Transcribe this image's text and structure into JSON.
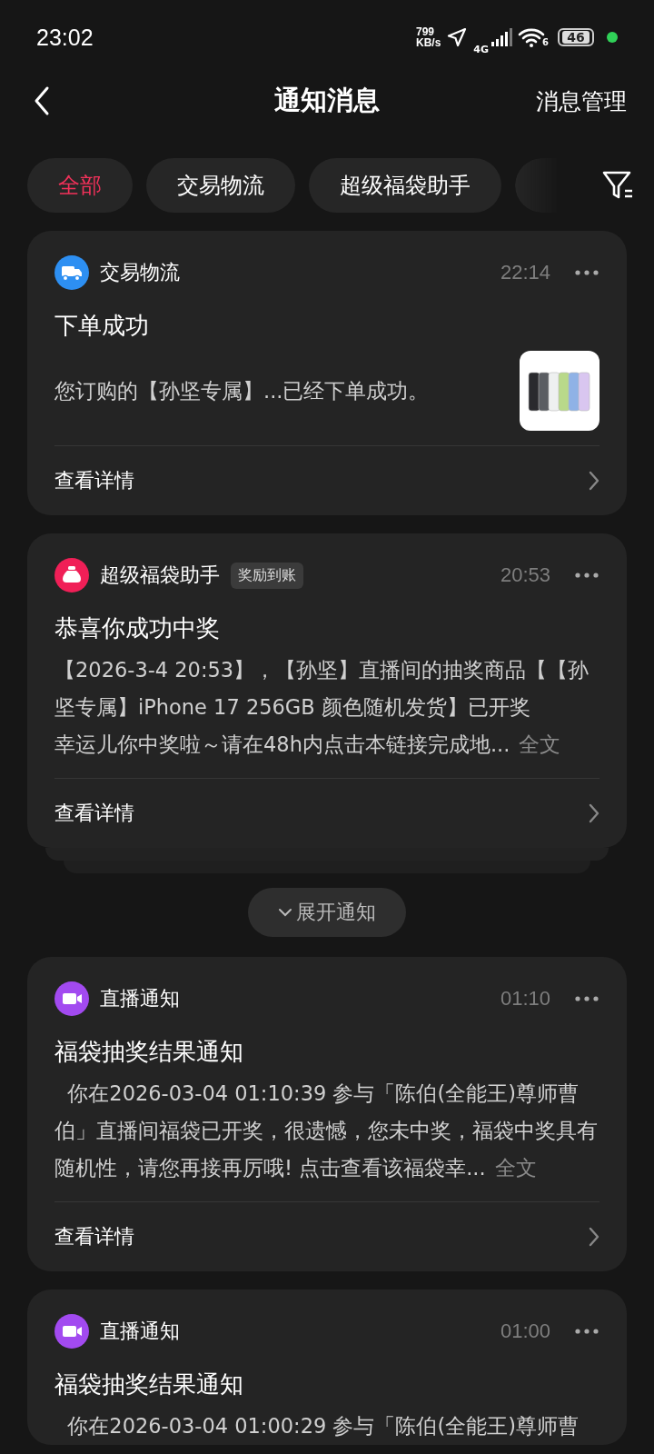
{
  "status_bar": {
    "time": "23:02",
    "speed": [
      "799",
      "KB/s"
    ],
    "network": "4G",
    "wifi_band": "6",
    "battery": "46"
  },
  "header": {
    "title": "通知消息",
    "action": "消息管理"
  },
  "tabs": [
    {
      "label": "全部",
      "selected": true
    },
    {
      "label": "交易物流",
      "selected": false
    },
    {
      "label": "超级福袋助手",
      "selected": false
    }
  ],
  "notifications": [
    {
      "kind": "logistics",
      "source": "交易物流",
      "time": "22:14",
      "title": "下单成功",
      "body": [
        "您订购的【孙坚专属】...已经下单成功。"
      ],
      "thumbnail": {
        "kind": "picture"
      },
      "action": "查看详情",
      "stacked": false
    },
    {
      "kind": "lucky_bag",
      "source": "超级福袋助手",
      "tag": "奖励到账",
      "time": "20:53",
      "title": "恭喜你成功中奖",
      "body": [
        "【2026-3-4 20:53】，【孙坚】直播间的抽奖商品【【孙坚专属】iPhone 17 256GB 颜色随机发货】已开奖",
        "幸运儿你中奖啦～请在48h内点击本链接完成地..."
      ],
      "more": "全文",
      "action": "查看详情",
      "stacked": true,
      "expand_label": "展开通知"
    },
    {
      "kind": "live",
      "source": "直播通知",
      "time": "01:10",
      "title": "福袋抽奖结果通知",
      "body": [
        "  你在2026-03-04 01:10:39 参与「陈伯(全能王)尊师曹伯」直播间福袋已开奖，很遗憾，您未中奖，福袋中奖具有随机性，请您再接再厉哦! 点击查看该福袋幸..."
      ],
      "more": "全文",
      "action": "查看详情",
      "stacked": false
    },
    {
      "kind": "live",
      "source": "直播通知",
      "time": "01:00",
      "title": "福袋抽奖结果通知",
      "body": [
        "  你在2026-03-04 01:00:29 参与「陈伯(全能王)尊师曹"
      ],
      "stacked": false
    }
  ]
}
